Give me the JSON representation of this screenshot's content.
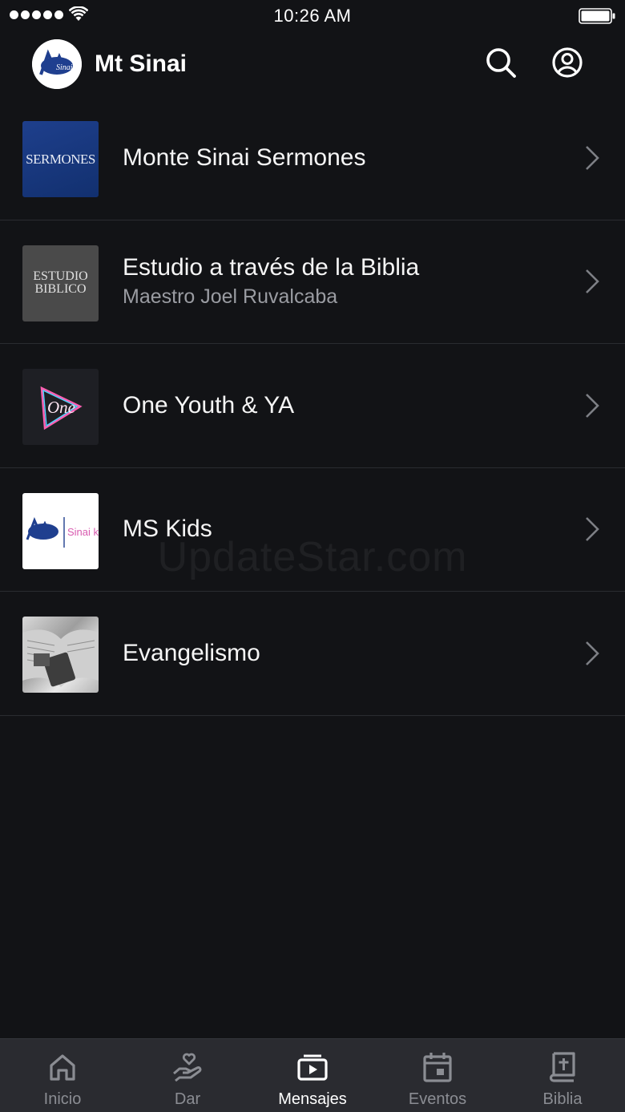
{
  "status_bar": {
    "time": "10:26 AM"
  },
  "header": {
    "title": "Mt Sinai",
    "logo_text": "Sinai"
  },
  "series": [
    {
      "title": "Monte Sinai Sermones",
      "subtitle": "",
      "thumb_text": "SERMONES"
    },
    {
      "title": "Estudio a través de la Biblia",
      "subtitle": "Maestro Joel Ruvalcaba",
      "thumb_text": "ESTUDIO BIBLICO"
    },
    {
      "title": "One Youth & YA",
      "subtitle": "",
      "thumb_text": "One"
    },
    {
      "title": "MS Kids",
      "subtitle": "",
      "thumb_text": "Sinai kids"
    },
    {
      "title": "Evangelismo",
      "subtitle": "",
      "thumb_text": ""
    }
  ],
  "watermark": "UpdateStar.com",
  "tabs": [
    {
      "label": "Inicio",
      "icon": "home-icon",
      "active": false
    },
    {
      "label": "Dar",
      "icon": "give-icon",
      "active": false
    },
    {
      "label": "Mensajes",
      "icon": "media-icon",
      "active": true
    },
    {
      "label": "Eventos",
      "icon": "calendar-icon",
      "active": false
    },
    {
      "label": "Biblia",
      "icon": "bible-icon",
      "active": false
    }
  ],
  "colors": {
    "background": "#121316",
    "tab_bar": "#2a2b30",
    "inactive": "#8b8d93",
    "active": "#ffffff"
  }
}
